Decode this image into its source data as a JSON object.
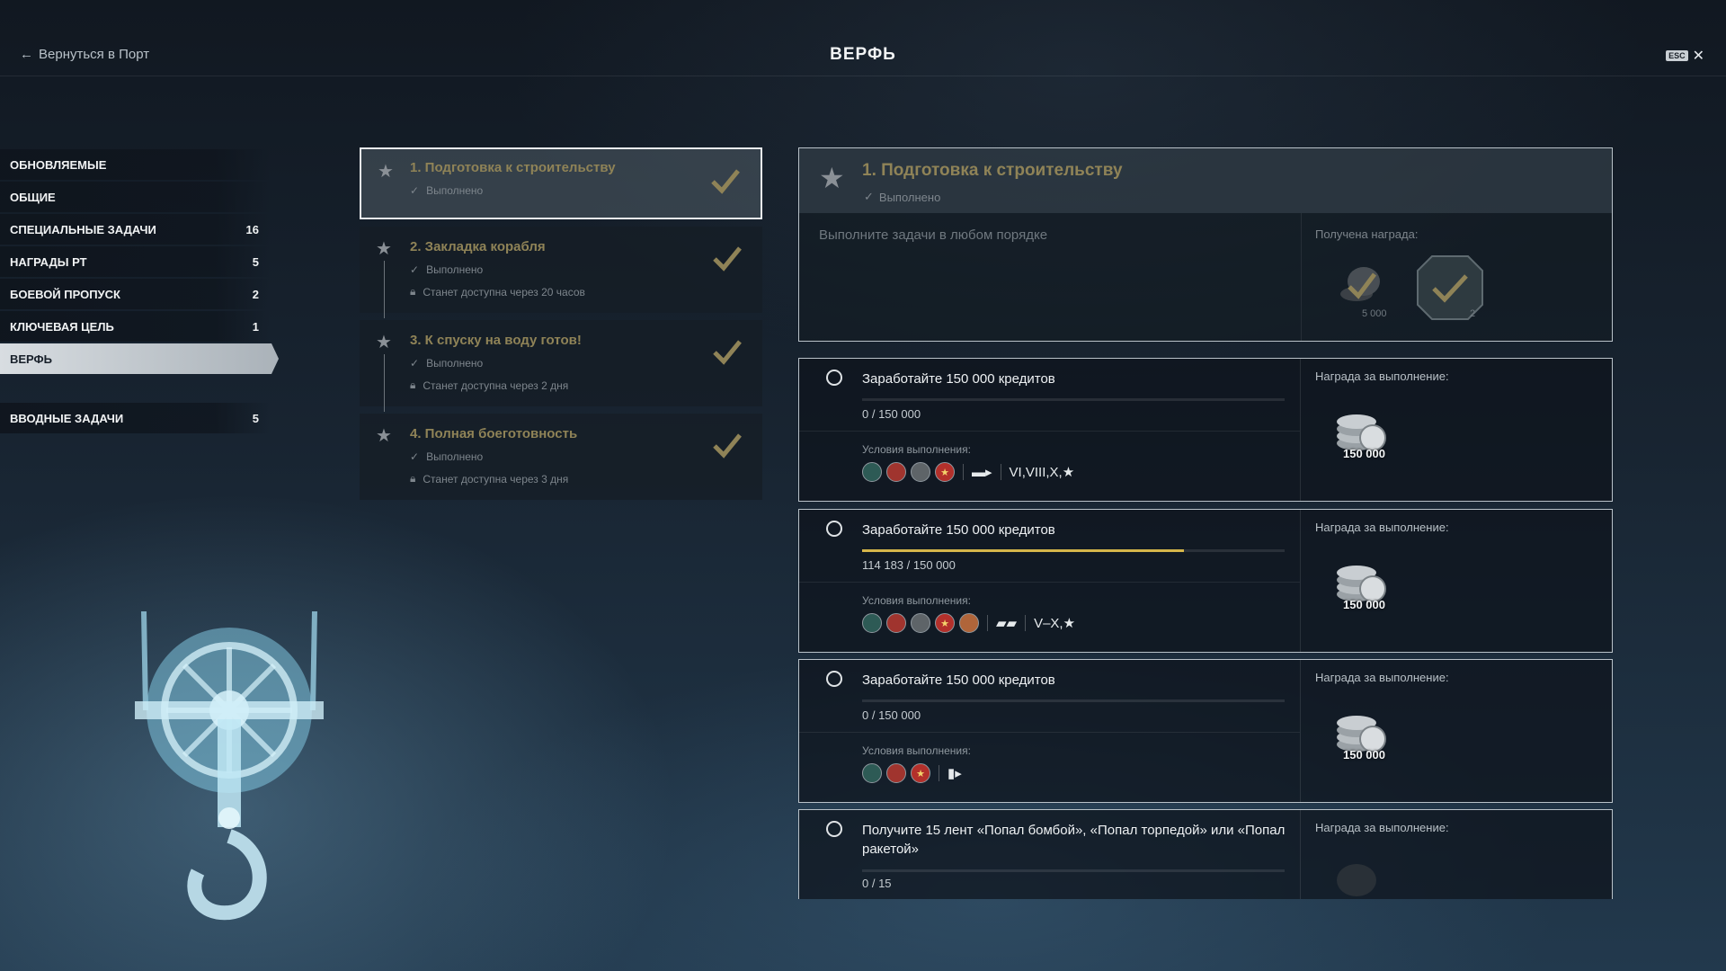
{
  "header": {
    "back_label": "Вернуться в Порт",
    "title": "ВЕРФЬ",
    "esc_label": "ESC"
  },
  "sidebar": {
    "items": [
      {
        "label": "ОБНОВЛЯЕМЫЕ",
        "count": ""
      },
      {
        "label": "ОБЩИЕ",
        "count": ""
      },
      {
        "label": "СПЕЦИАЛЬНЫЕ ЗАДАЧИ",
        "count": "16"
      },
      {
        "label": "НАГРАДЫ РТ",
        "count": "5"
      },
      {
        "label": "БОЕВОЙ ПРОПУСК",
        "count": "2"
      },
      {
        "label": "КЛЮЧЕВАЯ ЦЕЛЬ",
        "count": "1"
      },
      {
        "label": "ВЕРФЬ",
        "count": ""
      },
      {
        "label": "ВВОДНЫЕ ЗАДАЧИ",
        "count": "5"
      }
    ]
  },
  "steps": [
    {
      "title": "1. Подготовка к строительству",
      "status": "Выполнено",
      "lock": ""
    },
    {
      "title": "2. Закладка корабля",
      "status": "Выполнено",
      "lock": "Станет доступна через 20 часов"
    },
    {
      "title": "3. К спуску на воду готов!",
      "status": "Выполнено",
      "lock": "Станет доступна через 2 дня"
    },
    {
      "title": "4. Полная боеготовность",
      "status": "Выполнено",
      "lock": "Станет доступна через 3 дня"
    }
  ],
  "detail": {
    "title": "1. Подготовка к строительству",
    "status": "Выполнено",
    "description": "Выполните задачи в любом порядке",
    "reward_label": "Получена награда:",
    "reward_1_amount": "5 000",
    "reward_2_amount": "2"
  },
  "tasks": [
    {
      "title": "Заработайте 150 000 кредитов",
      "progress": "0 / 150 000",
      "progress_fraction": 0.0,
      "cond_label": "Условия выполнения:",
      "tiers": "VI,VIII,X,★",
      "reward_label": "Награда за выполнение:",
      "reward_amount": "150 000"
    },
    {
      "title": "Заработайте 150 000 кредитов",
      "progress": "114 183 / 150 000",
      "progress_fraction": 0.761,
      "cond_label": "Условия выполнения:",
      "tiers": "V–X,★",
      "reward_label": "Награда за выполнение:",
      "reward_amount": "150 000"
    },
    {
      "title": "Заработайте 150 000 кредитов",
      "progress": "0 / 150 000",
      "progress_fraction": 0.0,
      "cond_label": "Условия выполнения:",
      "tiers": "",
      "reward_label": "Награда за выполнение:",
      "reward_amount": "150 000"
    },
    {
      "title": "Получите 15 лент «Попал бомбой», «Попал торпедой» или «Попал ракетой»",
      "progress": "0 / 15",
      "progress_fraction": 0.0,
      "cond_label": "",
      "tiers": "",
      "reward_label": "Награда за выполнение:",
      "reward_amount": ""
    }
  ],
  "colors": {
    "gold_text": "#8f8357",
    "progress_fill": "#d6b64a"
  }
}
